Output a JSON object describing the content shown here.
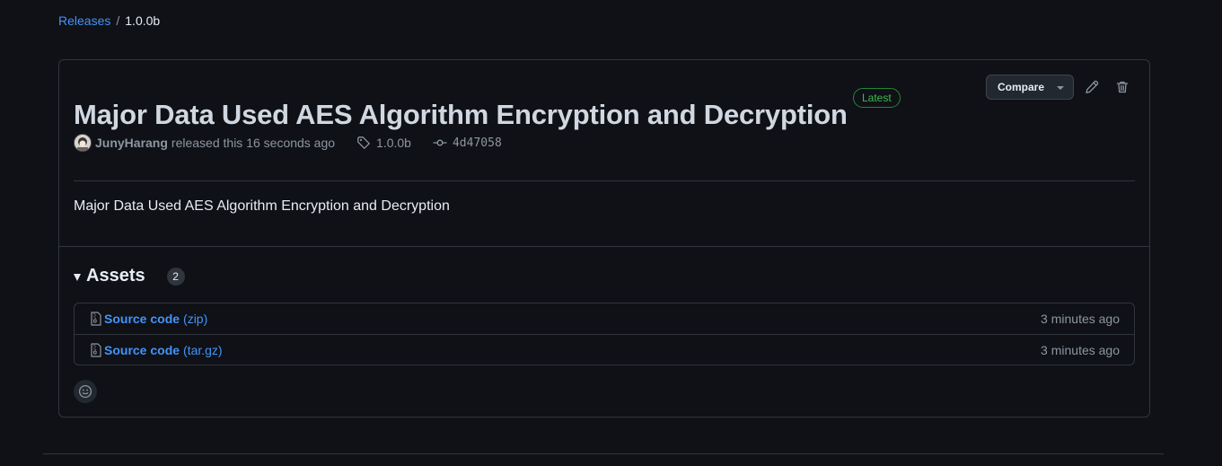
{
  "breadcrumb": {
    "root_label": "Releases",
    "separator": "/",
    "current": "1.0.0b"
  },
  "release": {
    "title": "Major Data Used AES Algorithm Encryption and Decryption",
    "badge": "Latest",
    "compare_label": "Compare",
    "author": "JunyHarang",
    "released_text": "released this 16 seconds ago",
    "tag": "1.0.0b",
    "commit": "4d47058",
    "body": "Major Data Used AES Algorithm Encryption and Decryption",
    "icons": {
      "edit": "pencil-icon",
      "delete": "trash-icon",
      "tag": "tag-icon",
      "commit": "git-commit-icon",
      "reaction": "smiley-icon",
      "archive": "file-zip-icon"
    }
  },
  "assets": {
    "title": "Assets",
    "count": "2",
    "items": [
      {
        "name": "Source code",
        "ext": "(zip)",
        "time": "3 minutes ago"
      },
      {
        "name": "Source code",
        "ext": "(tar.gz)",
        "time": "3 minutes ago"
      }
    ]
  },
  "colors": {
    "background": "#0f1116",
    "border": "#30363d",
    "link": "#4493f8",
    "muted": "#8d96a0",
    "success": "#3fb950"
  }
}
